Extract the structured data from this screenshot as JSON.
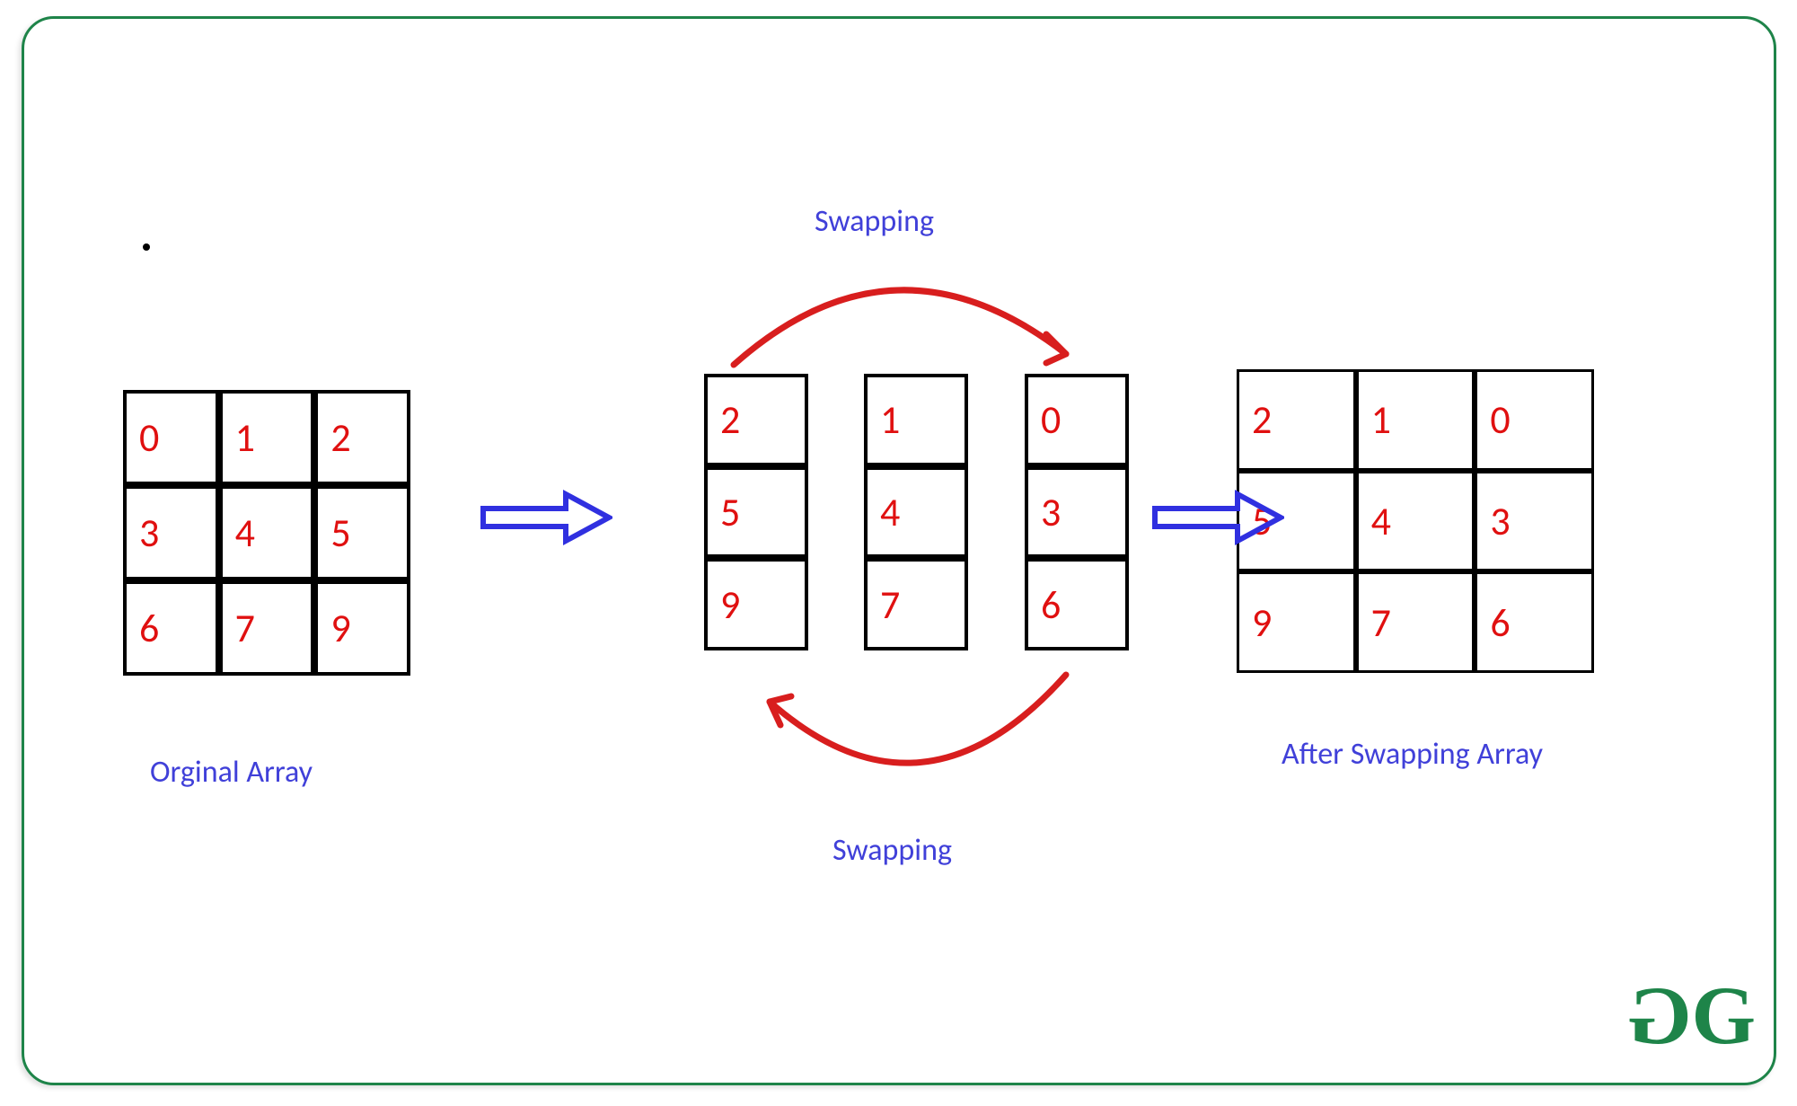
{
  "labels": {
    "swapping_top": "Swapping",
    "swapping_bottom": "Swapping",
    "original": "Orginal Array",
    "after": "After Swapping Array"
  },
  "arrays": {
    "original": [
      [
        "0",
        "1",
        "2"
      ],
      [
        "3",
        "4",
        "5"
      ],
      [
        "6",
        "7",
        "9"
      ]
    ],
    "middle_col1": [
      "2",
      "5",
      "9"
    ],
    "middle_col2": [
      "1",
      "4",
      "7"
    ],
    "middle_col3": [
      "0",
      "3",
      "6"
    ],
    "after": [
      [
        "2",
        "1",
        "0"
      ],
      [
        "5",
        "4",
        "3"
      ],
      [
        "9",
        "7",
        "6"
      ]
    ]
  },
  "colors": {
    "cell_text": "#e01010",
    "label_text": "#4040d9",
    "frame": "#1e8449",
    "swap_arrow": "#d81e1e",
    "flow_arrow": "#3030e0"
  },
  "logo": {
    "g1": "G",
    "g2": "G"
  }
}
